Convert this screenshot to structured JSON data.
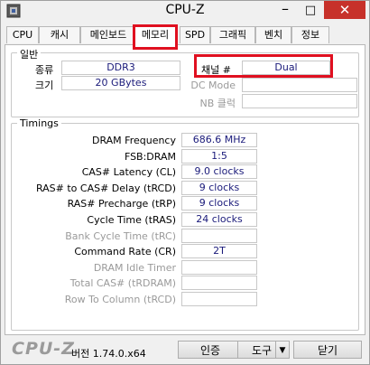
{
  "window": {
    "title": "CPU-Z"
  },
  "tabs": [
    {
      "label": "CPU"
    },
    {
      "label": "캐시"
    },
    {
      "label": "메인보드"
    },
    {
      "label": "메모리"
    },
    {
      "label": "SPD"
    },
    {
      "label": "그래픽"
    },
    {
      "label": "벤치"
    },
    {
      "label": "정보"
    }
  ],
  "general": {
    "legend": "일반",
    "type_label": "종류",
    "type_value": "DDR3",
    "size_label": "크기",
    "size_value": "20 GBytes",
    "channel_label": "채널 #",
    "channel_value": "Dual",
    "dc_mode_label": "DC Mode",
    "dc_mode_value": "",
    "nb_clock_label": "NB 클럭",
    "nb_clock_value": ""
  },
  "timings": {
    "legend": "Timings",
    "rows": [
      {
        "label": "DRAM Frequency",
        "value": "686.6 MHz"
      },
      {
        "label": "FSB:DRAM",
        "value": "1:5"
      },
      {
        "label": "CAS# Latency (CL)",
        "value": "9.0 clocks"
      },
      {
        "label": "RAS# to CAS# Delay (tRCD)",
        "value": "9 clocks"
      },
      {
        "label": "RAS# Precharge (tRP)",
        "value": "9 clocks"
      },
      {
        "label": "Cycle Time (tRAS)",
        "value": "24 clocks"
      },
      {
        "label": "Bank Cycle Time (tRC)",
        "value": ""
      },
      {
        "label": "Command Rate (CR)",
        "value": "2T"
      },
      {
        "label": "DRAM Idle Timer",
        "value": ""
      },
      {
        "label": "Total CAS# (tRDRAM)",
        "value": ""
      },
      {
        "label": "Row To Column (tRCD)",
        "value": ""
      }
    ]
  },
  "footer": {
    "logo": "CPU-Z",
    "version": "버전 1.74.0.x64",
    "validate_label": "인증",
    "tools_label": "도구",
    "close_label": "닫기"
  }
}
